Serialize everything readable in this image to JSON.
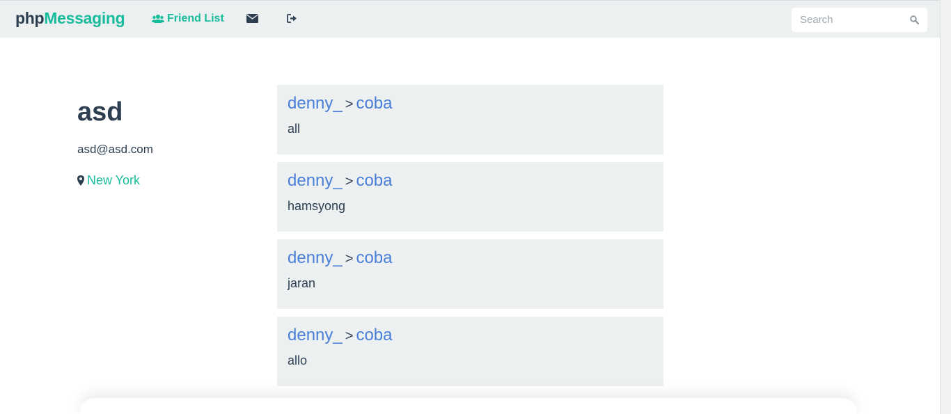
{
  "navbar": {
    "brand_php": "php",
    "brand_messaging": "Messaging",
    "friend_list_label": "Friend List",
    "icons": {
      "friends": "users-icon",
      "messages": "envelope-icon",
      "logout": "sign-out-icon",
      "search": "search-icon"
    },
    "search": {
      "placeholder": "Search",
      "value": ""
    }
  },
  "profile": {
    "name": "asd",
    "email": "asd@asd.com",
    "location": "New York",
    "location_icon": "map-marker-icon"
  },
  "messages": [
    {
      "from": "denny_",
      "separator": ">",
      "to": "coba",
      "text": "all"
    },
    {
      "from": "denny_",
      "separator": ">",
      "to": "coba",
      "text": "hamsyong"
    },
    {
      "from": "denny_",
      "separator": ">",
      "to": "coba",
      "text": "jaran"
    },
    {
      "from": "denny_",
      "separator": ">",
      "to": "coba",
      "text": "allo"
    }
  ],
  "colors": {
    "accent": "#18bc9c",
    "primary_text": "#2c3e50",
    "link_blue": "#4a7fd8",
    "panel_bg": "#ecf0f1"
  }
}
